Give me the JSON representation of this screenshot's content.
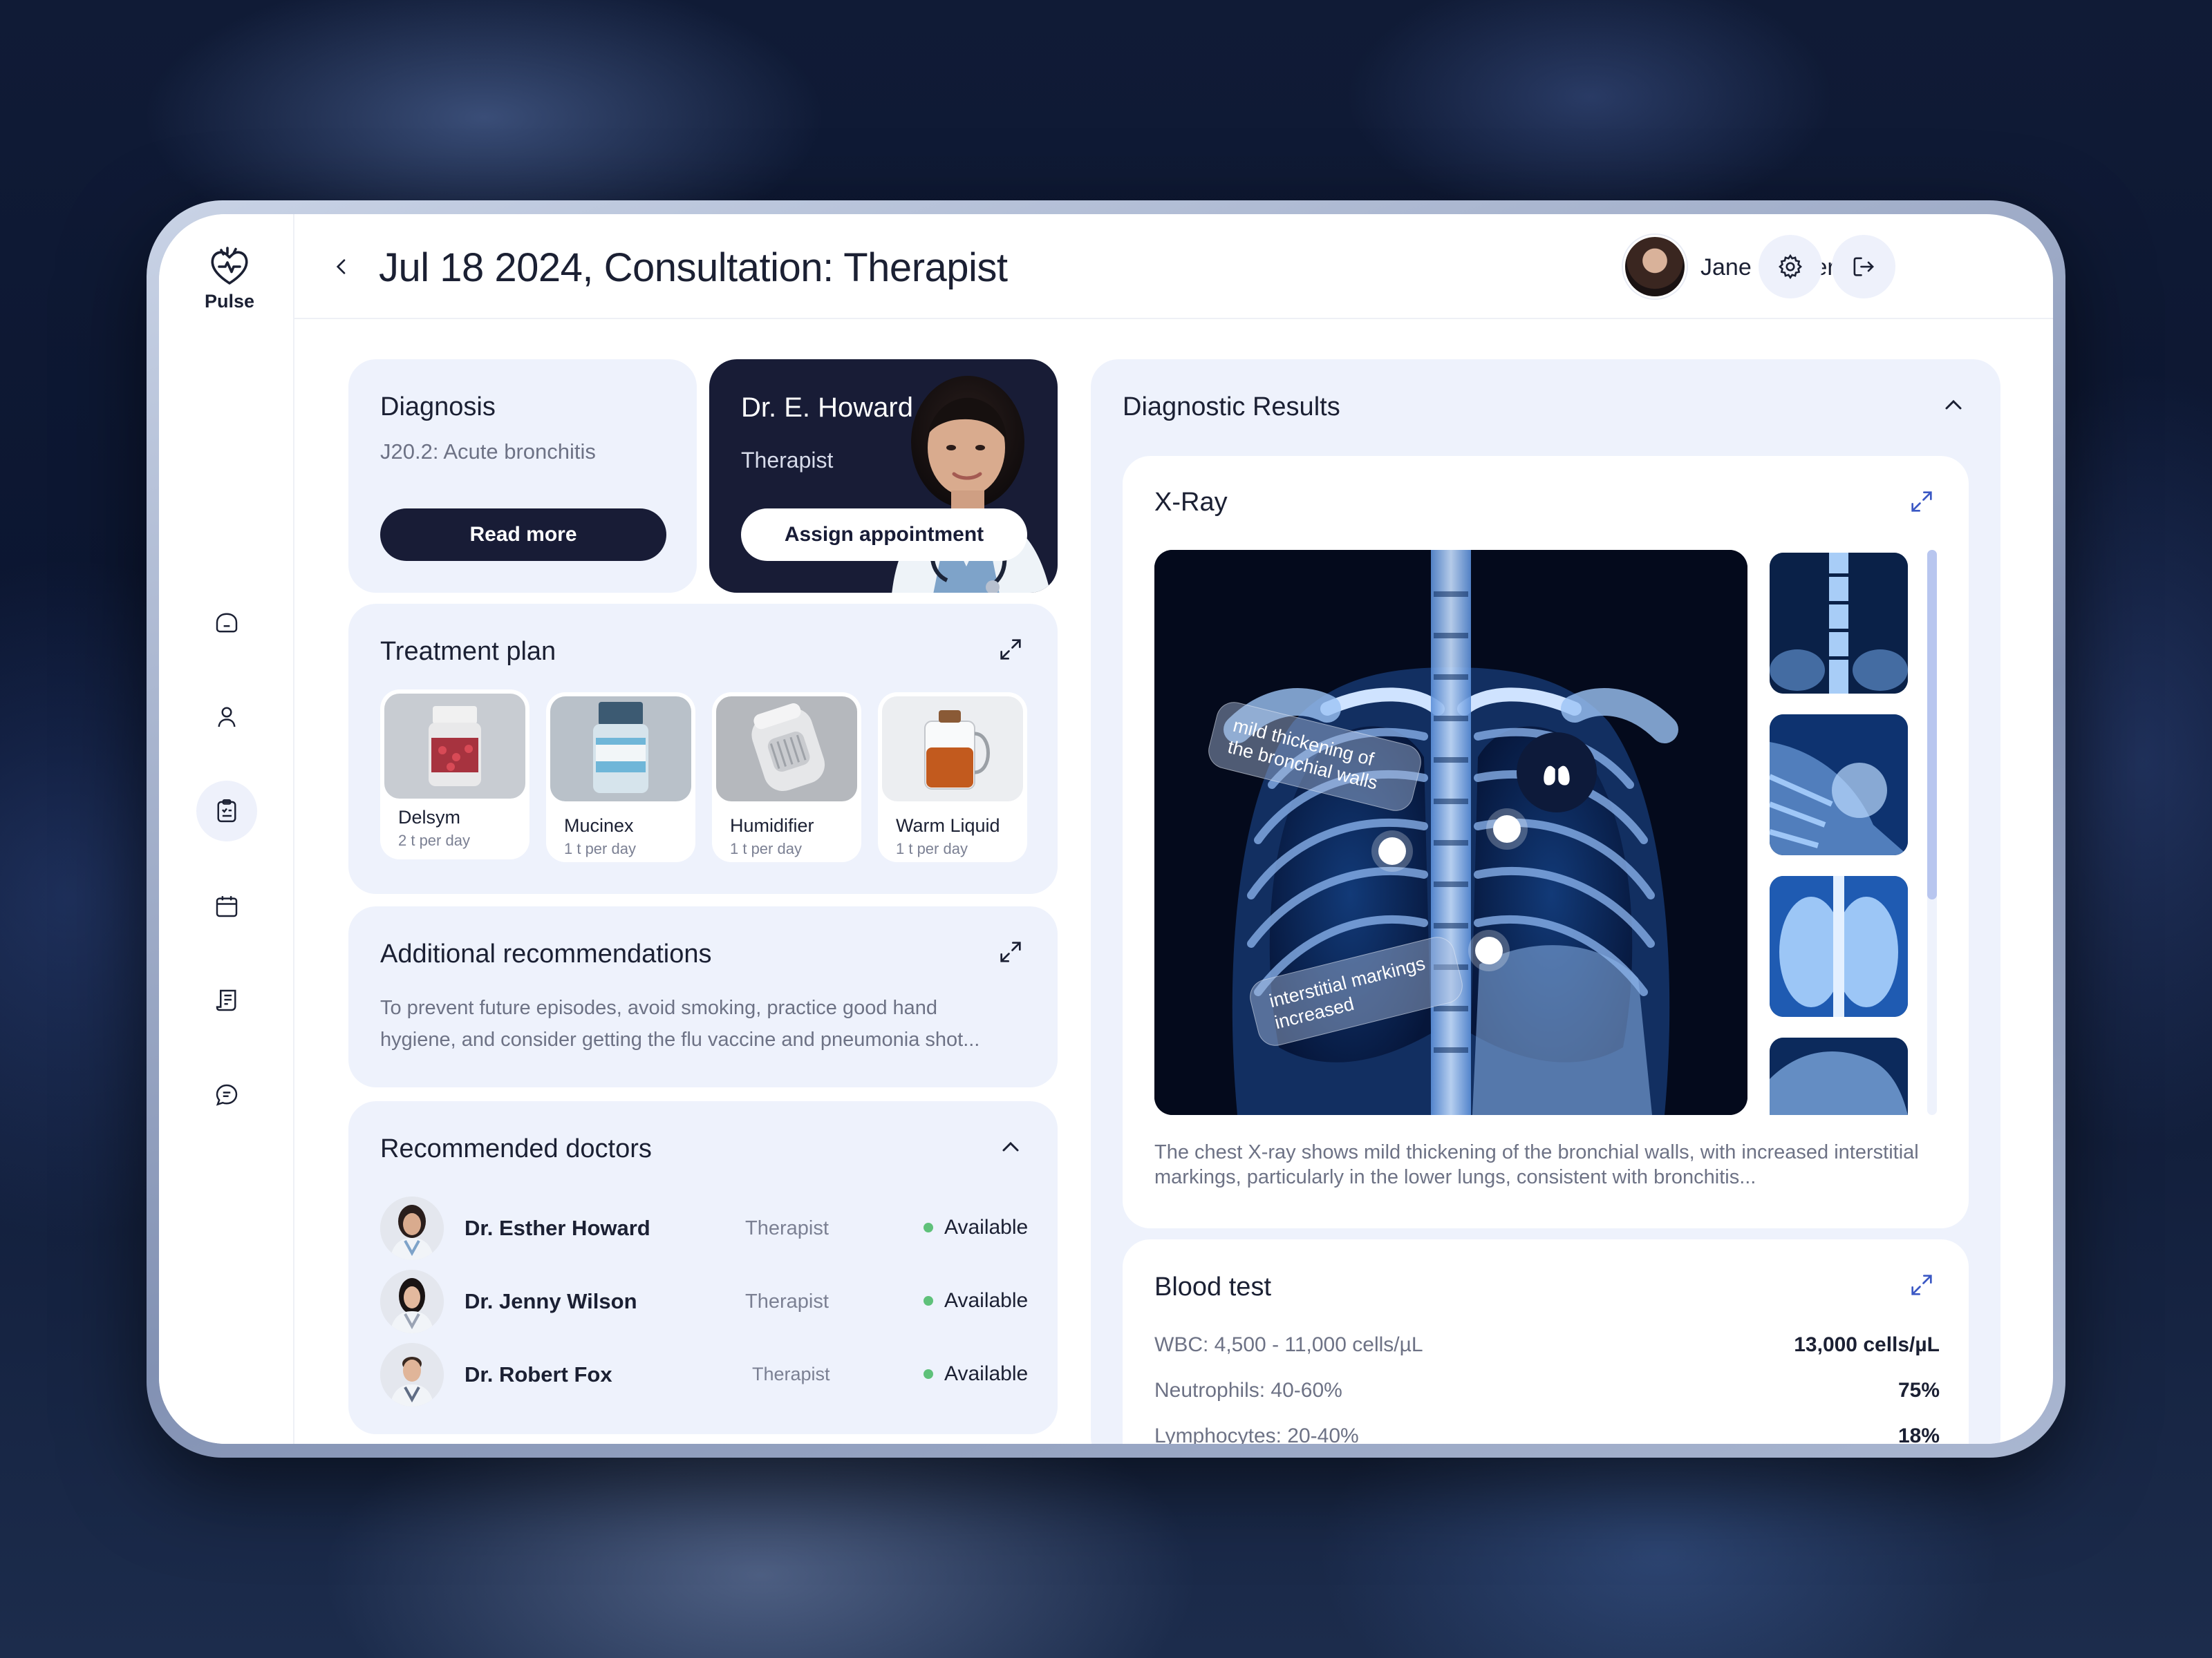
{
  "app": {
    "logo_text": "Pulse"
  },
  "header": {
    "title": "Jul 18 2024, Consultation: Therapist",
    "user_name": "Jane Cooper"
  },
  "sidebar": {
    "items": [
      {
        "name": "home",
        "icon": "home-icon",
        "active": false
      },
      {
        "name": "profile",
        "icon": "user-icon",
        "active": false
      },
      {
        "name": "records",
        "icon": "clipboard-icon",
        "active": true
      },
      {
        "name": "calendar",
        "icon": "calendar-icon",
        "active": false
      },
      {
        "name": "documents",
        "icon": "receipt-icon",
        "active": false
      },
      {
        "name": "messages",
        "icon": "chat-icon",
        "active": false
      }
    ]
  },
  "diagnosis": {
    "title": "Diagnosis",
    "code": "J20.2: Acute bronchitis",
    "button": "Read more"
  },
  "doctor": {
    "name": "Dr. E. Howard",
    "role": "Therapist",
    "button": "Assign appointment"
  },
  "treatment": {
    "title": "Treatment plan",
    "items": [
      {
        "name": "Delsym",
        "dose": "2 t per day"
      },
      {
        "name": "Mucinex",
        "dose": "1 t per day"
      },
      {
        "name": "Humidifier",
        "dose": "1 t per day"
      },
      {
        "name": "Warm Liquid",
        "dose": "1 t per day"
      }
    ]
  },
  "recommendations": {
    "title": "Additional recommendations",
    "text": "To prevent future episodes, avoid smoking, practice good hand hygiene, and consider getting the flu vaccine and pneumonia shot..."
  },
  "doctors": {
    "title": "Recommended doctors",
    "items": [
      {
        "name": "Dr. Esther Howard",
        "role": "Therapist",
        "status": "Available"
      },
      {
        "name": "Dr. Jenny Wilson",
        "role": "Therapist",
        "status": "Available"
      },
      {
        "name": "Dr. Robert Fox",
        "role": "Therapist",
        "status": "Available"
      }
    ]
  },
  "results": {
    "title": "Diagnostic Results",
    "xray": {
      "title": "X-Ray",
      "tag1": "mild thickening of the bronchial walls",
      "tag2": "interstitial markings increased",
      "description": "The chest X-ray shows mild thickening of the bronchial walls, with increased interstitial markings, particularly in the lower lungs, consistent with bronchitis..."
    },
    "blood": {
      "title": "Blood test",
      "rows": [
        {
          "label": "WBC: 4,500 - 11,000 cells/µL",
          "value": "13,000 cells/µL"
        },
        {
          "label": "Neutrophils: 40-60%",
          "value": "75%"
        },
        {
          "label": "Lymphocytes: 20-40%",
          "value": "18%"
        }
      ]
    }
  },
  "colors": {
    "accent_dark": "#181c36",
    "card_bg": "#eef2fc",
    "status_green": "#5fc17a",
    "icon_accent": "#3b58c4"
  }
}
